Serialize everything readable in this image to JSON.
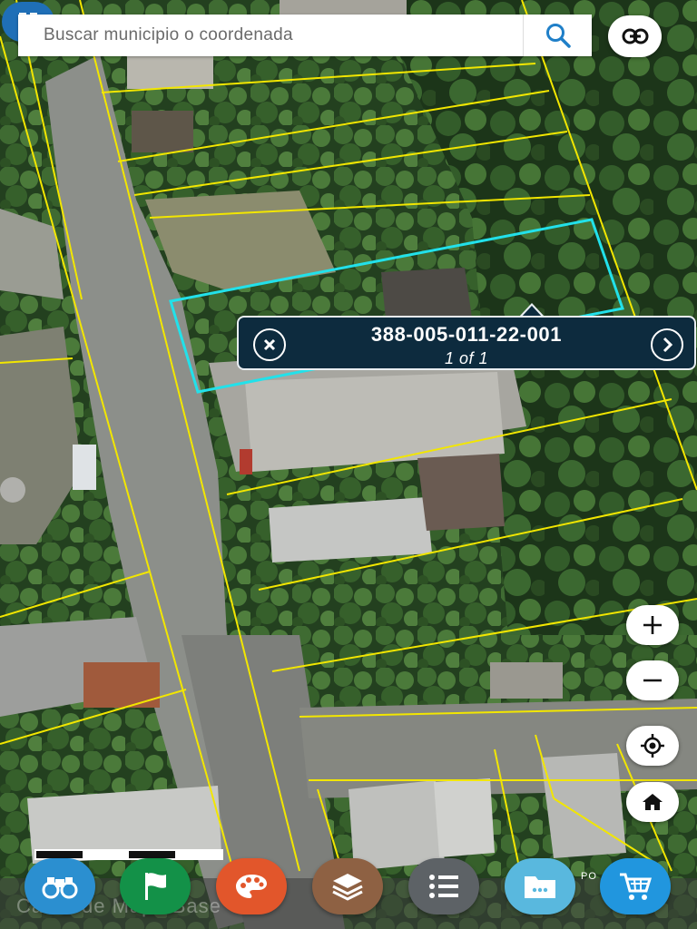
{
  "search": {
    "placeholder": "Buscar municipio o coordenada"
  },
  "popup": {
    "parcel_id": "388-005-011-22-001",
    "count": "1 of 1"
  },
  "footer": {
    "text": "Cabra de Mapa Base",
    "right_text": "PO"
  },
  "colors": {
    "parcel_line": "#f2e600",
    "selected_parcel": "#22e1ea",
    "popup_bg": "#0d2b3e",
    "accent_blue": "#1f6fb7"
  },
  "tools": [
    {
      "name": "binoculars",
      "color": "#2b8fd0"
    },
    {
      "name": "flag",
      "color": "#139148"
    },
    {
      "name": "palette",
      "color": "#e2562b"
    },
    {
      "name": "layers",
      "color": "#8e6143"
    },
    {
      "name": "legend-list",
      "color": "#5d6266"
    },
    {
      "name": "folder",
      "color": "#59b8de"
    },
    {
      "name": "cart",
      "color": "#2196de"
    }
  ],
  "controls": [
    "zoom-in",
    "zoom-out",
    "locate",
    "home"
  ]
}
